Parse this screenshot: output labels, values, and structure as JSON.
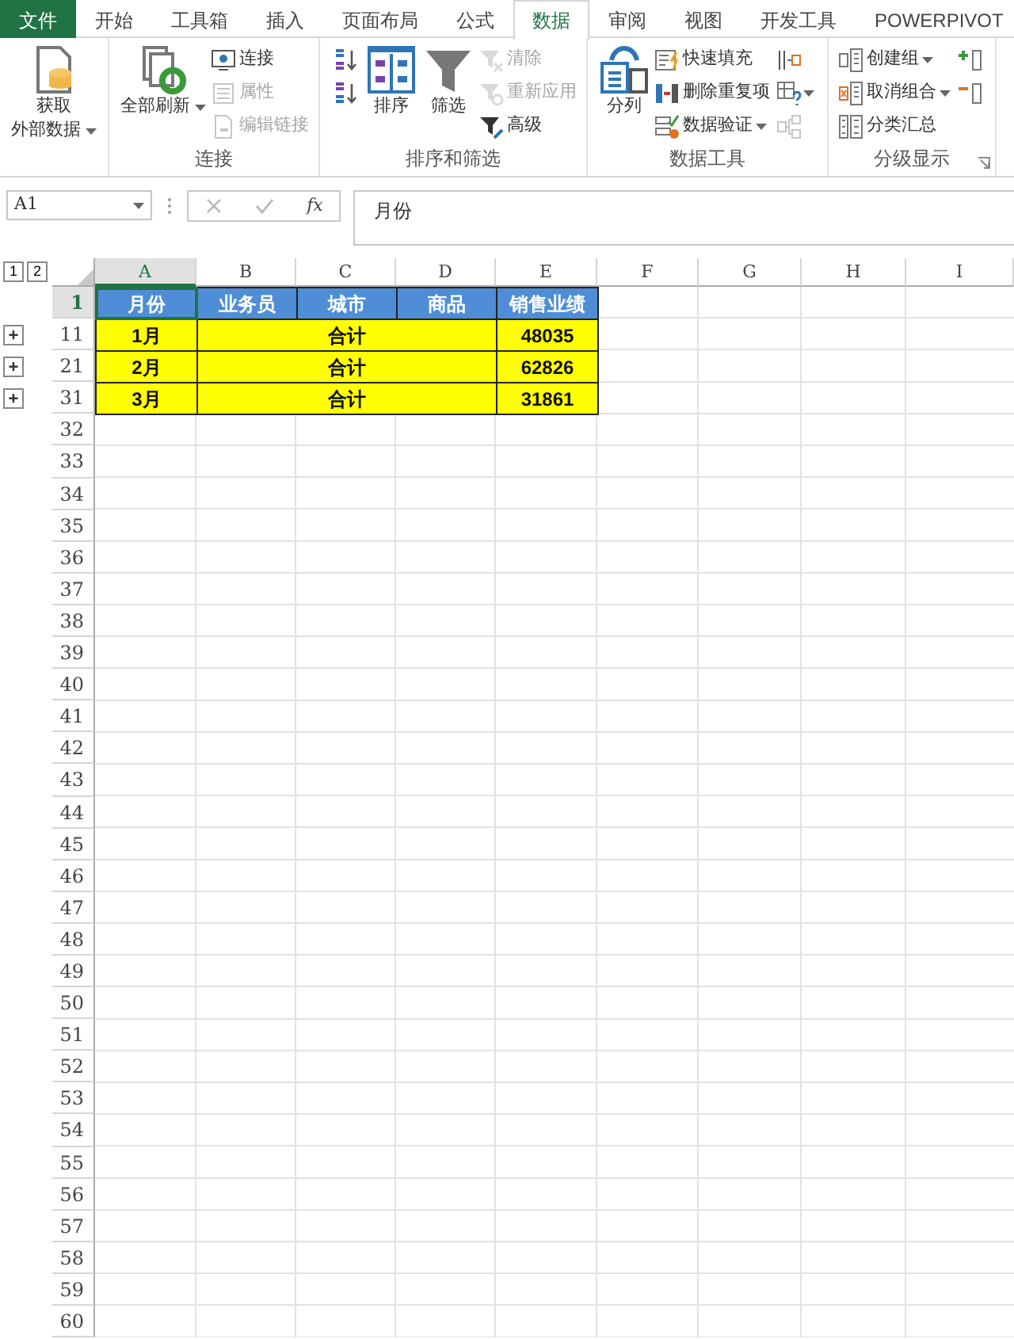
{
  "tabs": [
    {
      "label": "文件",
      "kind": "file",
      "selected": false
    },
    {
      "label": "开始",
      "kind": "tab",
      "selected": false
    },
    {
      "label": "工具箱",
      "kind": "tab",
      "selected": false
    },
    {
      "label": "插入",
      "kind": "tab",
      "selected": false
    },
    {
      "label": "页面布局",
      "kind": "tab",
      "selected": false
    },
    {
      "label": "公式",
      "kind": "tab",
      "selected": false
    },
    {
      "label": "数据",
      "kind": "tab",
      "selected": true
    },
    {
      "label": "审阅",
      "kind": "tab",
      "selected": false
    },
    {
      "label": "视图",
      "kind": "tab",
      "selected": false
    },
    {
      "label": "开发工具",
      "kind": "tab",
      "selected": false
    },
    {
      "label": "POWERPIVOT",
      "kind": "tab",
      "selected": false
    }
  ],
  "ribbon": {
    "groups": [
      {
        "columns": [
          [
            {
              "kind": "large",
              "label_lines": [
                "获取",
                "外部数据"
              ],
              "disabled": false,
              "dropdown": true
            }
          ]
        ]
      },
      {
        "label": "连接",
        "columns": [
          [
            {
              "kind": "large",
              "label_lines": [
                "全部刷新"
              ],
              "disabled": false,
              "dropdown": true
            }
          ],
          [
            {
              "kind": "small",
              "label": "连接",
              "disabled": false,
              "dropdown": false
            },
            {
              "kind": "small",
              "label": "属性",
              "disabled": true,
              "dropdown": false
            },
            {
              "kind": "small",
              "label": "编辑链接",
              "disabled": true,
              "dropdown": false
            }
          ]
        ]
      },
      {
        "label": "排序和筛选",
        "columns": [
          [
            {
              "kind": "icon",
              "disabled": false,
              "dropdown": false
            },
            {
              "kind": "icon",
              "disabled": false,
              "dropdown": false
            }
          ],
          [
            {
              "kind": "large",
              "label_lines": [
                "排序"
              ],
              "disabled": false,
              "dropdown": false
            }
          ],
          [
            {
              "kind": "large",
              "label_lines": [
                "筛选"
              ],
              "disabled": false,
              "dropdown": false
            }
          ],
          [
            {
              "kind": "small",
              "label": "清除",
              "disabled": true,
              "dropdown": false
            },
            {
              "kind": "small",
              "label": "重新应用",
              "disabled": true,
              "dropdown": false
            },
            {
              "kind": "small",
              "label": "高级",
              "disabled": false,
              "dropdown": false
            }
          ]
        ]
      },
      {
        "label": "数据工具",
        "columns": [
          [
            {
              "kind": "large",
              "label_lines": [
                "分列"
              ],
              "disabled": false,
              "dropdown": false
            }
          ],
          [
            {
              "kind": "small",
              "label": "快速填充",
              "disabled": false,
              "dropdown": false
            },
            {
              "kind": "small",
              "label": "删除重复项",
              "disabled": false,
              "dropdown": false
            },
            {
              "kind": "small",
              "label": "数据验证",
              "disabled": false,
              "dropdown": true
            }
          ],
          [
            {
              "kind": "icon",
              "disabled": false,
              "dropdown": false
            },
            {
              "kind": "icon",
              "disabled": false,
              "dropdown": true
            },
            {
              "kind": "icon",
              "disabled": true,
              "dropdown": false
            }
          ]
        ]
      },
      {
        "label": "分级显示",
        "launcher": true,
        "columns": [
          [
            {
              "kind": "small",
              "label": "创建组",
              "disabled": false,
              "dropdown": true
            },
            {
              "kind": "small",
              "label": "取消组合",
              "disabled": false,
              "dropdown": true
            },
            {
              "kind": "small",
              "label": "分类汇总",
              "disabled": false,
              "dropdown": false
            }
          ],
          [
            {
              "kind": "icon",
              "disabled": false,
              "dropdown": false
            },
            {
              "kind": "icon",
              "disabled": false,
              "dropdown": false
            }
          ]
        ]
      }
    ]
  },
  "formula_bar": {
    "name_box": "A1",
    "function_label": "fx",
    "formula": "月份"
  },
  "sheet": {
    "outline_levels": [
      "1",
      "2"
    ],
    "columns": [
      {
        "label": "A",
        "selected": true
      },
      {
        "label": "B",
        "selected": false
      },
      {
        "label": "C",
        "selected": false
      },
      {
        "label": "D",
        "selected": false
      },
      {
        "label": "E",
        "selected": false
      },
      {
        "label": "F",
        "selected": false
      },
      {
        "label": "G",
        "selected": false
      },
      {
        "label": "H",
        "selected": false
      },
      {
        "label": "I",
        "selected": false
      }
    ],
    "rows": [
      {
        "number": "1",
        "selected": true,
        "kind": "header",
        "cells": [
          {
            "text": "月份",
            "active": true,
            "kind": "single"
          },
          {
            "text": "业务员",
            "active": false,
            "kind": "single"
          },
          {
            "text": "城市",
            "active": false,
            "kind": "single"
          },
          {
            "text": "商品",
            "active": false,
            "kind": "single"
          },
          {
            "text": "销售业绩",
            "active": false,
            "kind": "single"
          }
        ]
      },
      {
        "number": "11",
        "selected": false,
        "kind": "total",
        "outline_button": "+",
        "cells": [
          {
            "text": "1月",
            "active": false,
            "kind": "single"
          },
          {
            "text": "合计",
            "active": false,
            "kind": "merged"
          },
          {
            "text": "48035",
            "active": false,
            "kind": "single"
          }
        ]
      },
      {
        "number": "21",
        "selected": false,
        "kind": "total",
        "outline_button": "+",
        "cells": [
          {
            "text": "2月",
            "active": false,
            "kind": "single"
          },
          {
            "text": "合计",
            "active": false,
            "kind": "merged"
          },
          {
            "text": "62826",
            "active": false,
            "kind": "single"
          }
        ]
      },
      {
        "number": "31",
        "selected": false,
        "kind": "total",
        "outline_button": "+",
        "cells": [
          {
            "text": "3月",
            "active": false,
            "kind": "single"
          },
          {
            "text": "合计",
            "active": false,
            "kind": "merged"
          },
          {
            "text": "31861",
            "active": false,
            "kind": "single"
          }
        ]
      },
      {
        "number": "32",
        "selected": false,
        "kind": "empty"
      },
      {
        "number": "33",
        "selected": false,
        "kind": "empty"
      },
      {
        "number": "34",
        "selected": false,
        "kind": "empty"
      },
      {
        "number": "35",
        "selected": false,
        "kind": "empty"
      },
      {
        "number": "36",
        "selected": false,
        "kind": "empty"
      },
      {
        "number": "37",
        "selected": false,
        "kind": "empty"
      },
      {
        "number": "38",
        "selected": false,
        "kind": "empty"
      },
      {
        "number": "39",
        "selected": false,
        "kind": "empty"
      },
      {
        "number": "40",
        "selected": false,
        "kind": "empty"
      },
      {
        "number": "41",
        "selected": false,
        "kind": "empty"
      },
      {
        "number": "42",
        "selected": false,
        "kind": "empty"
      },
      {
        "number": "43",
        "selected": false,
        "kind": "empty"
      },
      {
        "number": "44",
        "selected": false,
        "kind": "empty"
      },
      {
        "number": "45",
        "selected": false,
        "kind": "empty"
      },
      {
        "number": "46",
        "selected": false,
        "kind": "empty"
      },
      {
        "number": "47",
        "selected": false,
        "kind": "empty"
      },
      {
        "number": "48",
        "selected": false,
        "kind": "empty"
      },
      {
        "number": "49",
        "selected": false,
        "kind": "empty"
      },
      {
        "number": "50",
        "selected": false,
        "kind": "empty"
      },
      {
        "number": "51",
        "selected": false,
        "kind": "empty"
      },
      {
        "number": "52",
        "selected": false,
        "kind": "empty"
      },
      {
        "number": "53",
        "selected": false,
        "kind": "empty"
      },
      {
        "number": "54",
        "selected": false,
        "kind": "empty"
      },
      {
        "number": "55",
        "selected": false,
        "kind": "empty"
      },
      {
        "number": "56",
        "selected": false,
        "kind": "empty"
      },
      {
        "number": "57",
        "selected": false,
        "kind": "empty"
      },
      {
        "number": "58",
        "selected": false,
        "kind": "empty"
      },
      {
        "number": "59",
        "selected": false,
        "kind": "empty"
      },
      {
        "number": "60",
        "selected": false,
        "kind": "empty"
      }
    ]
  }
}
